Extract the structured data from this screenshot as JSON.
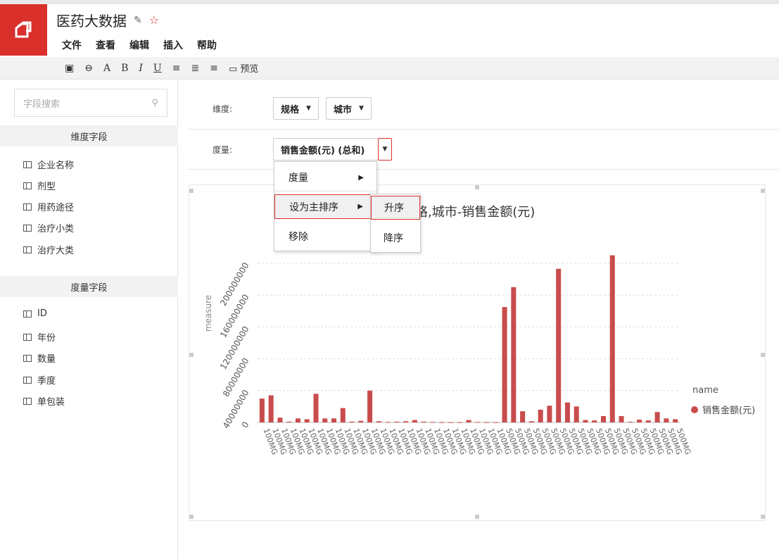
{
  "app": {
    "title": "医药大数据",
    "edit_icon": "edit-icon",
    "star_icon": "star-icon"
  },
  "menubar": [
    "文件",
    "查看",
    "编辑",
    "插入",
    "帮助"
  ],
  "toolbar": {
    "bold": "B",
    "italic": "I",
    "underline": "U",
    "font": "A",
    "preview": "预览"
  },
  "sidebar": {
    "search_placeholder": "字段搜索",
    "dimension_header": "维度字段",
    "dimension_fields": [
      "企业名称",
      "剂型",
      "用药途径",
      "治疗小类",
      "治疗大类"
    ],
    "measure_header": "度量字段",
    "measure_fields": [
      "ID",
      "年份",
      "数量",
      "季度",
      "单包装"
    ]
  },
  "config": {
    "dimension_label": "维度:",
    "dimensions": [
      "规格",
      "城市"
    ],
    "measure_label": "度量:",
    "measure_value": "销售金额(元) (总和)"
  },
  "context_menu": {
    "items": [
      "度量",
      "设为主排序",
      "移除"
    ],
    "submenu": [
      "升序",
      "降序"
    ]
  },
  "chart_data": {
    "type": "bar",
    "title": "格,城市-销售金额(元)",
    "ylabel": "measure",
    "ylim": [
      0,
      230000000
    ],
    "yticks": [
      0,
      40000000,
      80000000,
      120000000,
      160000000,
      200000000
    ],
    "legend_title": "name",
    "legend_position": "right",
    "series": [
      {
        "name": "销售金额(元)",
        "color": "#c94c4c",
        "values": [
          30000000,
          34000000,
          6000000,
          1000000,
          5000000,
          4000000,
          36000000,
          5000000,
          5000000,
          18000000,
          1000000,
          2000000,
          40000000,
          1500000,
          500000,
          1000000,
          1500000,
          3000000,
          1000000,
          500000,
          300000,
          300000,
          300000,
          3000000,
          500000,
          300000,
          300000,
          145000000,
          170000000,
          14000000,
          1500000,
          16000000,
          21000000,
          193000000,
          25000000,
          20000000,
          3000000,
          2500000,
          8000000,
          210000000,
          8000000,
          800000,
          3500000,
          2500000,
          13000000,
          5000000,
          4000000
        ]
      }
    ],
    "categories_prefix": [
      "100MG",
      "500MG"
    ]
  }
}
